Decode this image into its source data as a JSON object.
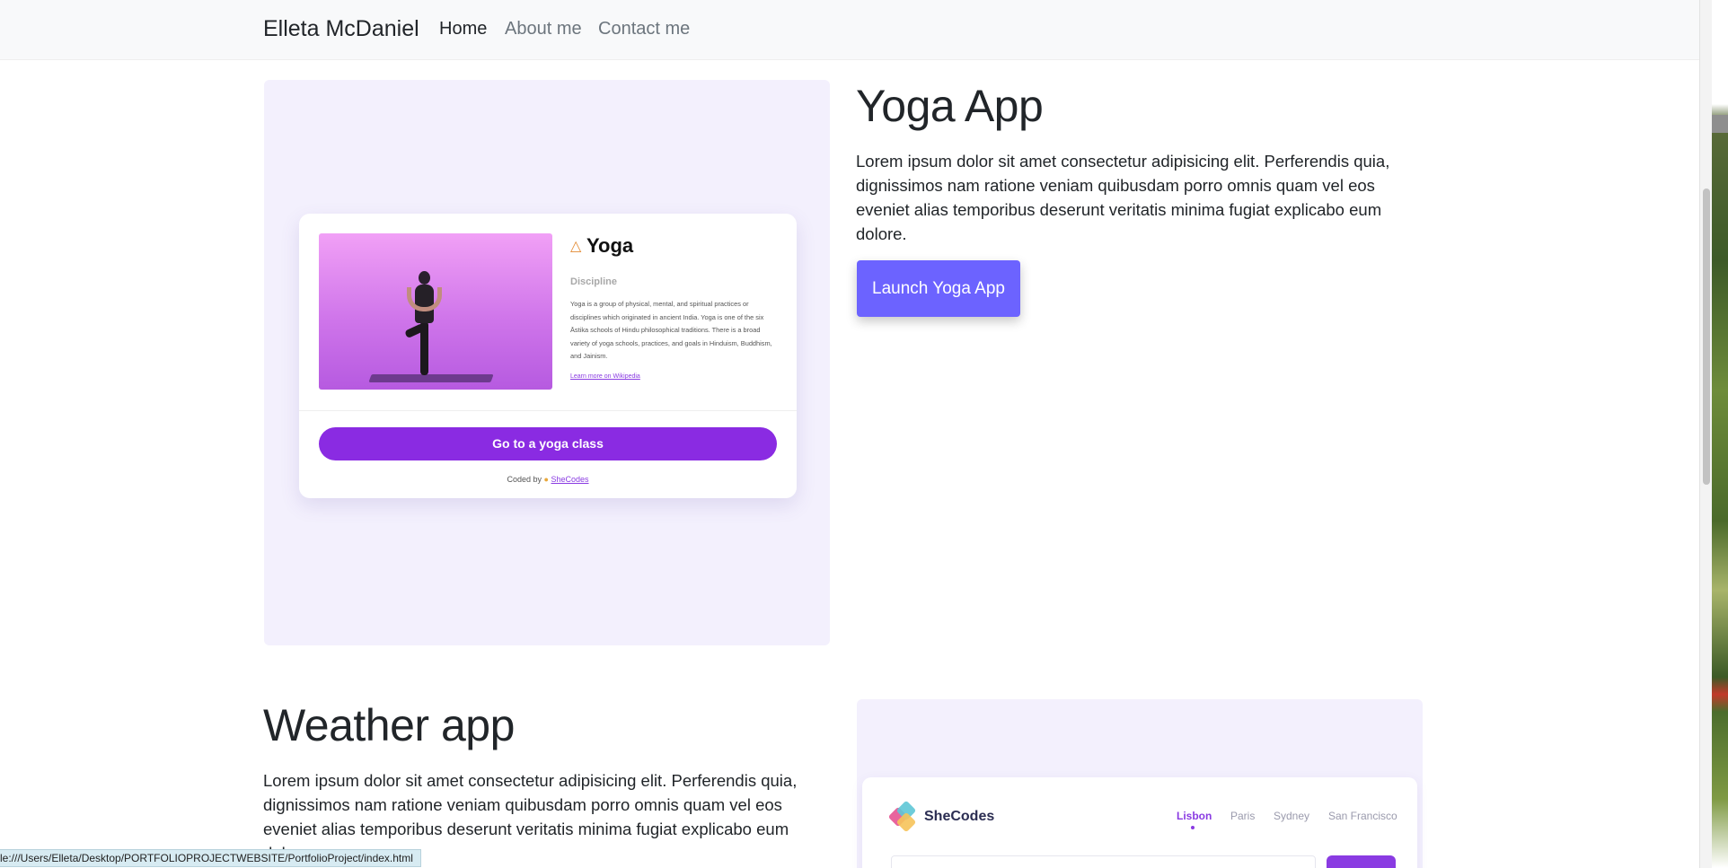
{
  "nav": {
    "brand": "Elleta McDaniel",
    "links": [
      "Home",
      "About me",
      "Contact me"
    ],
    "active": "Home"
  },
  "yoga": {
    "title": "Yoga App",
    "description": "Lorem ipsum dolor sit amet consectetur adipisicing elit. Perferendis quia, dignissimos nam ratione veniam quibusdam porro omnis quam vel eos eveniet alias temporibus deserunt veritatis minima fugiat explicabo eum dolore.",
    "launch_label": "Launch Yoga App",
    "card": {
      "heading": "Yoga",
      "subheading": "Discipline",
      "text": "Yoga is a group of physical, mental, and spiritual practices or disciplines which originated in ancient India. Yoga is one of the six Āstika schools of Hindu philosophical traditions. There is a broad variety of yoga schools, practices, and goals in Hinduism, Buddhism, and Jainism.",
      "link": "Learn more on Wikipedia",
      "button": "Go to a yoga class",
      "coded_by": "Coded by",
      "coded_link": "SheCodes"
    }
  },
  "weather": {
    "title": "Weather app",
    "description": "Lorem ipsum dolor sit amet consectetur adipisicing elit. Perferendis quia, dignissimos nam ratione veniam quibusdam porro omnis quam vel eos eveniet alias temporibus deserunt veritatis minima fugiat explicabo eum dolore.",
    "card": {
      "logo_text": "SheCodes",
      "cities": [
        "Lisbon",
        "Paris",
        "Sydney",
        "San Francisco"
      ],
      "active_city": "Lisbon"
    }
  },
  "status_bar": {
    "url": "le:///Users/Elleta/Desktop/PORTFOLIOPROJECTWEBSITE/PortfolioProject/index.html"
  },
  "colors": {
    "accent": "#6c63ff",
    "card_purple": "#8a2be2",
    "panel_bg": "#f3f0fd"
  }
}
